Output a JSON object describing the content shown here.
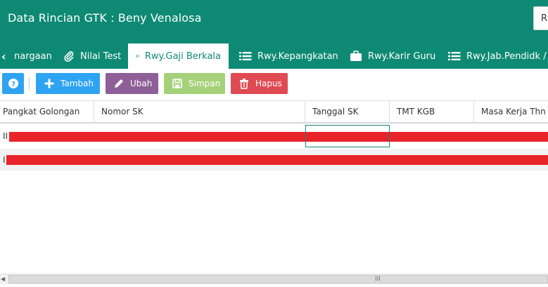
{
  "header": {
    "title": "Data Rincian GTK : Beny Venalosa",
    "right_button": "Rw"
  },
  "tabs": [
    {
      "label": "nargaan",
      "icon": "award-icon"
    },
    {
      "label": "Nilai Test",
      "icon": "paperclip-icon"
    },
    {
      "label": "Rwy.Gaji Berkala",
      "icon": "money-icon",
      "active": true
    },
    {
      "label": "Rwy.Kepangkatan",
      "icon": "list-icon"
    },
    {
      "label": "Rwy.Karir Guru",
      "icon": "briefcase-icon"
    },
    {
      "label": "Rwy.Jab.Pendidk / Te",
      "icon": "list-icon"
    }
  ],
  "toolbar": {
    "help_icon": "question-icon",
    "add_label": "Tambah",
    "edit_label": "Ubah",
    "save_label": "Simpan",
    "delete_label": "Hapus"
  },
  "grid": {
    "columns": [
      "Pangkat Golongan",
      "Nomor SK",
      "Tanggal SK",
      "TMT KGB",
      "Masa Kerja Thn"
    ],
    "rows": [
      {
        "prefix": "II"
      },
      {
        "prefix": "I"
      }
    ]
  },
  "scrollbar": {
    "grip": "III"
  },
  "colors": {
    "brand": "#0e8a74",
    "add": "#2ea3f2",
    "edit": "#8e5f98",
    "save": "#a5d17a",
    "delete": "#e04a52",
    "redaction": "#e8242a"
  }
}
